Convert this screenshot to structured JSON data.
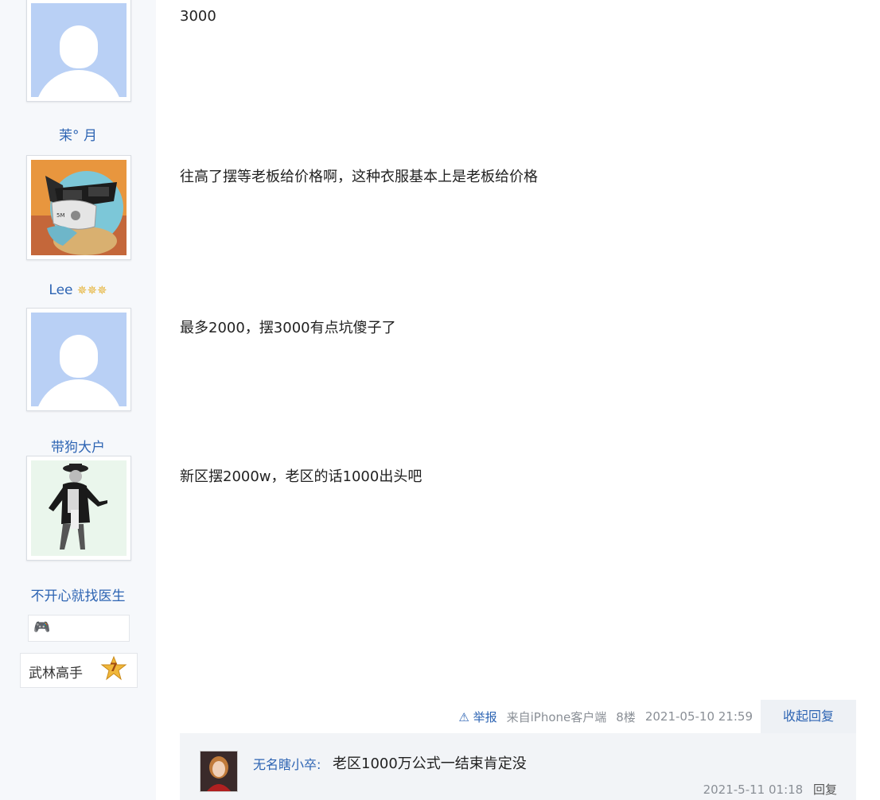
{
  "posts": [
    {
      "username": "茉° 月",
      "text": "3000"
    },
    {
      "username": "Lee",
      "text": "往高了摆等老板给价格啊，这种衣服基本上是老板给价格"
    },
    {
      "username": "带狗大户",
      "text": "最多2000，摆3000有点坑傻子了"
    },
    {
      "username": "不开心就找医生",
      "text": "新区摆2000w，老区的话1000出头吧"
    }
  ],
  "badges": {
    "rank_label": "武林高手",
    "rank_level": "7"
  },
  "footer": {
    "report": "举报",
    "source": "来自iPhone客户端",
    "floor": "8楼",
    "datetime": "2021-05-10 21:59",
    "collapse_reply": "收起回复"
  },
  "comment": {
    "user": "无名瞎小卒:",
    "text": "老区1000万公式一结束肯定没",
    "datetime": "2021-5-11 01:18",
    "reply": "回复"
  },
  "colors": {
    "link": "#2d64b3",
    "avatar_default_bg": "#b9d0f5",
    "sidebar_bg": "#f6f8fb"
  }
}
